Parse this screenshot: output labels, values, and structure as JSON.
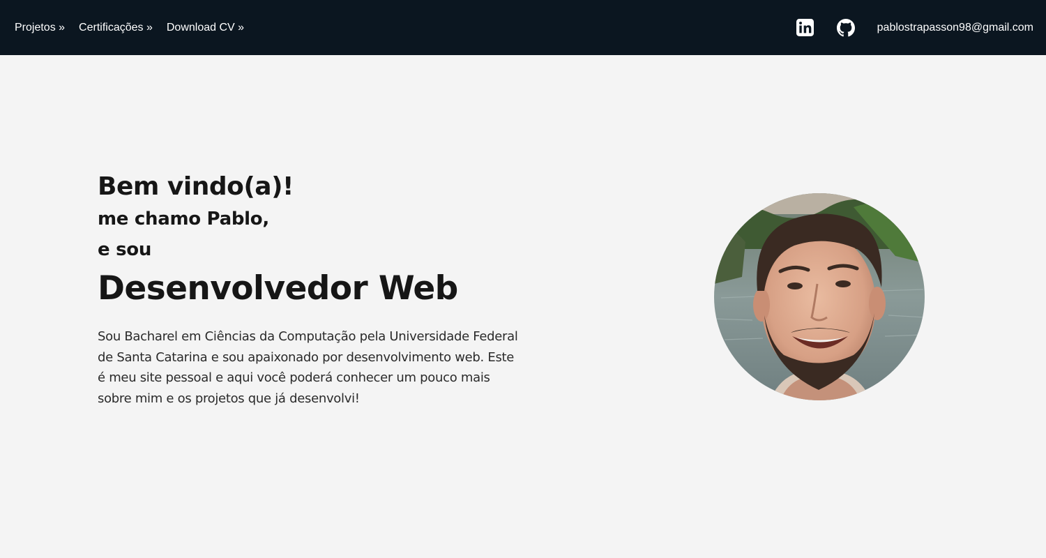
{
  "nav": {
    "links": [
      "Projetos »",
      "Certificações »",
      "Download CV »"
    ],
    "email": "pablostrapasson98@gmail.com",
    "icons": {
      "linkedin": "linkedin-icon",
      "github": "github-icon"
    }
  },
  "hero": {
    "greeting": "Bem vindo(a)!",
    "line1": "me chamo Pablo,",
    "line2": "e sou",
    "role": "Desenvolvedor Web",
    "bio": "Sou Bacharel em Ciências da Computação pela Universidade Federal de Santa Catarina e sou apaixonado por desenvolvimento web. Este é meu site pessoal e aqui você poderá conhecer um pouco mais sobre mim e os projetos que já desenvolvi!"
  },
  "colors": {
    "navbar_bg": "#0b1620",
    "page_bg": "#f4f4f4",
    "text": "#161616"
  }
}
